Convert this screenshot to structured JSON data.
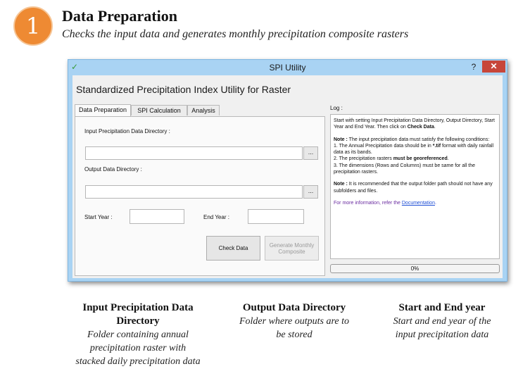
{
  "header": {
    "step_number": "1",
    "title": "Data Preparation",
    "subtitle": "Checks the input data and generates monthly precipitation composite rasters"
  },
  "window": {
    "title": "SPI Utility",
    "help_label": "?",
    "close_label": "✕",
    "heading": "Standardized Precipitation Index Utility for Raster",
    "tabs": [
      "Data Preparation",
      "SPI Calculation",
      "Analysis"
    ],
    "active_tab": "Data Preparation",
    "form": {
      "input_dir_label": "Input Precipitation Data Directory :",
      "input_dir_value": "",
      "output_dir_label": "Output Data Directory :",
      "output_dir_value": "",
      "browse_label": "...",
      "start_year_label": "Start Year :",
      "start_year_value": "",
      "end_year_label": "End Year :",
      "end_year_value": "",
      "check_button": "Check Data",
      "generate_button_line1": "Generate Monthly",
      "generate_button_line2": "Composite"
    },
    "log": {
      "label": "Log :",
      "intro_1": "Start with setting Input Precipitation Data Directory, Output Directory, Start Year and End Year. Then click on ",
      "intro_bold": "Check Data",
      "intro_end": ".",
      "note_label": "Note :",
      "note_text": " The input precipitation data must satisfy the following conditions:",
      "cond1_a": "1. The Annual Precipitation data should be in ",
      "cond1_b": "*.tif",
      "cond1_c": " format with daily rainfall data as its bands.",
      "cond2_a": "2. The precipitation rasters ",
      "cond2_b": "must be georeferenced",
      "cond2_c": ".",
      "cond3": "3. The dimensions (Rows and Columns) must be same for all the precipitation rasters.",
      "note2_label": "Note :",
      "note2_text": " It is recommended that the output folder path should not have any subfolders and files.",
      "more_info": "For more information, refer the ",
      "doc_link": "Documentation",
      "more_info_end": "."
    },
    "progress": {
      "value": 0,
      "label": "0%"
    }
  },
  "captions": [
    {
      "title_line1": "Input Precipitation Data",
      "title_line2": "Directory",
      "desc": [
        "Folder containing annual",
        "precipitation raster with",
        "stacked daily precipitation data"
      ]
    },
    {
      "title_line1": "Output Data Directory",
      "desc": [
        "Folder where outputs are to",
        "be stored"
      ]
    },
    {
      "title_line1": "Start and End year",
      "desc": [
        "Start and end year of the",
        "input precipitation data"
      ]
    }
  ],
  "colors": {
    "step_circle": "#ee8a33",
    "titlebar": "#a9d3f3",
    "close_button": "#c7463a",
    "link": "#1f4fd6"
  },
  "icons": [
    "app-icon",
    "close-icon",
    "help-icon"
  ]
}
